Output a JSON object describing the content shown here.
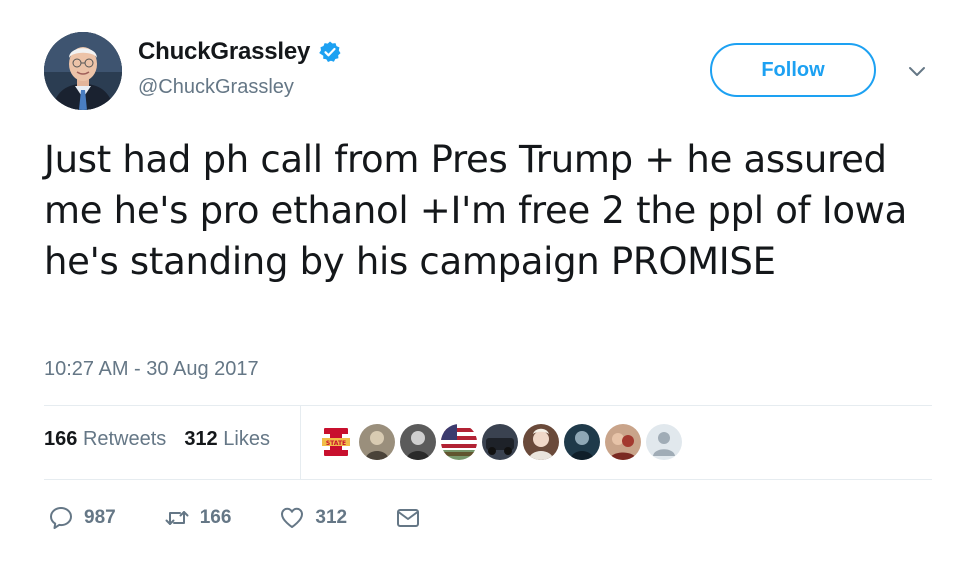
{
  "user": {
    "display_name": "ChuckGrassley",
    "handle": "@ChuckGrassley",
    "verified": true
  },
  "follow_label": "Follow",
  "tweet": {
    "text": "Just had ph call from Pres Trump + he assured me he's pro ethanol +I'm free 2 the ppl of Iowa he's standing by his campaign PROMISE",
    "timestamp": "10:27 AM - 30 Aug 2017"
  },
  "stats": {
    "retweets_count": "166",
    "retweets_label": "Retweets",
    "likes_count": "312",
    "likes_label": "Likes"
  },
  "actions": {
    "replies": "987",
    "retweets": "166",
    "likes": "312"
  },
  "colors": {
    "accent": "#1da1f2",
    "muted": "#657786",
    "text": "#14171a",
    "divider": "#e6ecf0"
  }
}
